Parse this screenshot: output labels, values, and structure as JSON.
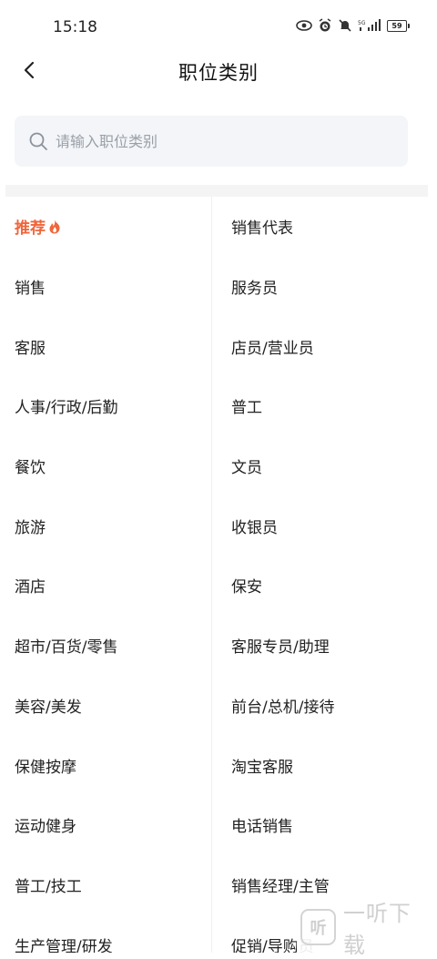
{
  "status_bar": {
    "time": "15:18",
    "battery": "59",
    "network": "5G"
  },
  "header": {
    "title": "职位类别"
  },
  "search": {
    "placeholder": "请输入职位类别",
    "value": ""
  },
  "left_column": [
    {
      "label": "推荐",
      "active": true,
      "icon": "fire-icon"
    },
    {
      "label": "销售"
    },
    {
      "label": "客服"
    },
    {
      "label": "人事/行政/后勤"
    },
    {
      "label": "餐饮"
    },
    {
      "label": "旅游"
    },
    {
      "label": "酒店"
    },
    {
      "label": "超市/百货/零售"
    },
    {
      "label": "美容/美发"
    },
    {
      "label": "保健按摩"
    },
    {
      "label": "运动健身"
    },
    {
      "label": "普工/技工"
    },
    {
      "label": "生产管理/研发"
    }
  ],
  "right_column": [
    {
      "label": "销售代表"
    },
    {
      "label": "服务员"
    },
    {
      "label": "店员/营业员"
    },
    {
      "label": "普工"
    },
    {
      "label": "文员"
    },
    {
      "label": "收银员"
    },
    {
      "label": "保安"
    },
    {
      "label": "客服专员/助理"
    },
    {
      "label": "前台/总机/接待"
    },
    {
      "label": "淘宝客服"
    },
    {
      "label": "电话销售"
    },
    {
      "label": "销售经理/主管"
    },
    {
      "label": "促销/导购员"
    }
  ],
  "watermark": {
    "text": "一听下载",
    "badge": "听"
  },
  "colors": {
    "accent": "#f0663c",
    "search_bg": "#f3f5f8",
    "text": "#222222"
  }
}
